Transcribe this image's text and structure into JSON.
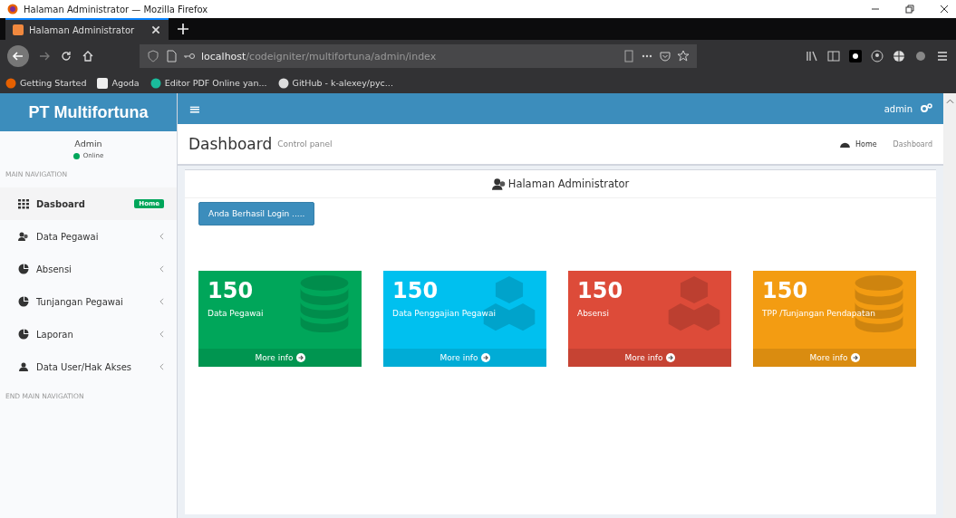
{
  "window": {
    "title": "Halaman Administrator — Mozilla Firefox"
  },
  "tabs": [
    {
      "label": "Halaman Administrator",
      "selected": true
    }
  ],
  "address": {
    "host": "localhost",
    "path": "/codeigniter/multifortuna/admin/index"
  },
  "bookmarks": [
    "Getting Started",
    "Agoda",
    "Editor PDF Online yan...",
    "GitHub - k-alexey/pyc..."
  ],
  "app": {
    "brand": "PT Multifortuna",
    "menu_toggle": "≡",
    "user_menu": "admin"
  },
  "user_panel": {
    "name": "Admin",
    "status": "Online"
  },
  "sidebar": {
    "header": "MAIN NAVIGATION",
    "footer": "END MAIN NAVIGATION",
    "items": [
      {
        "label": "Dasboard",
        "selected": true,
        "badge": "Home",
        "expandable": false
      },
      {
        "label": "Data Pegawai",
        "selected": false,
        "expandable": true
      },
      {
        "label": "Absensi",
        "selected": false,
        "expandable": true
      },
      {
        "label": "Tunjangan Pegawai",
        "selected": false,
        "expandable": true
      },
      {
        "label": "Laporan",
        "selected": false,
        "expandable": true
      },
      {
        "label": "Data User/Hak Akses",
        "selected": false,
        "expandable": true
      }
    ]
  },
  "page": {
    "title": "Dashboard",
    "subtitle": "Control panel",
    "breadcrumb": [
      "Home",
      "Dashboard"
    ]
  },
  "box": {
    "title": "Halaman Administrator",
    "button": "Anda Berhasil Login ....."
  },
  "cards": [
    {
      "value": "150",
      "label": "Data Pegawai",
      "link": "More info",
      "color": "#00a65a",
      "kind": "database"
    },
    {
      "value": "150",
      "label": "Data Penggajian Pegawai",
      "link": "More info",
      "color": "#00c0ef",
      "kind": "cubes"
    },
    {
      "value": "150",
      "label": "Absensi",
      "link": "More info",
      "color": "#dd4b39",
      "kind": "cubes"
    },
    {
      "value": "150",
      "label": "TPP /Tunjangan Pendapatan",
      "link": "More info",
      "color": "#f39c12",
      "kind": "database"
    }
  ]
}
